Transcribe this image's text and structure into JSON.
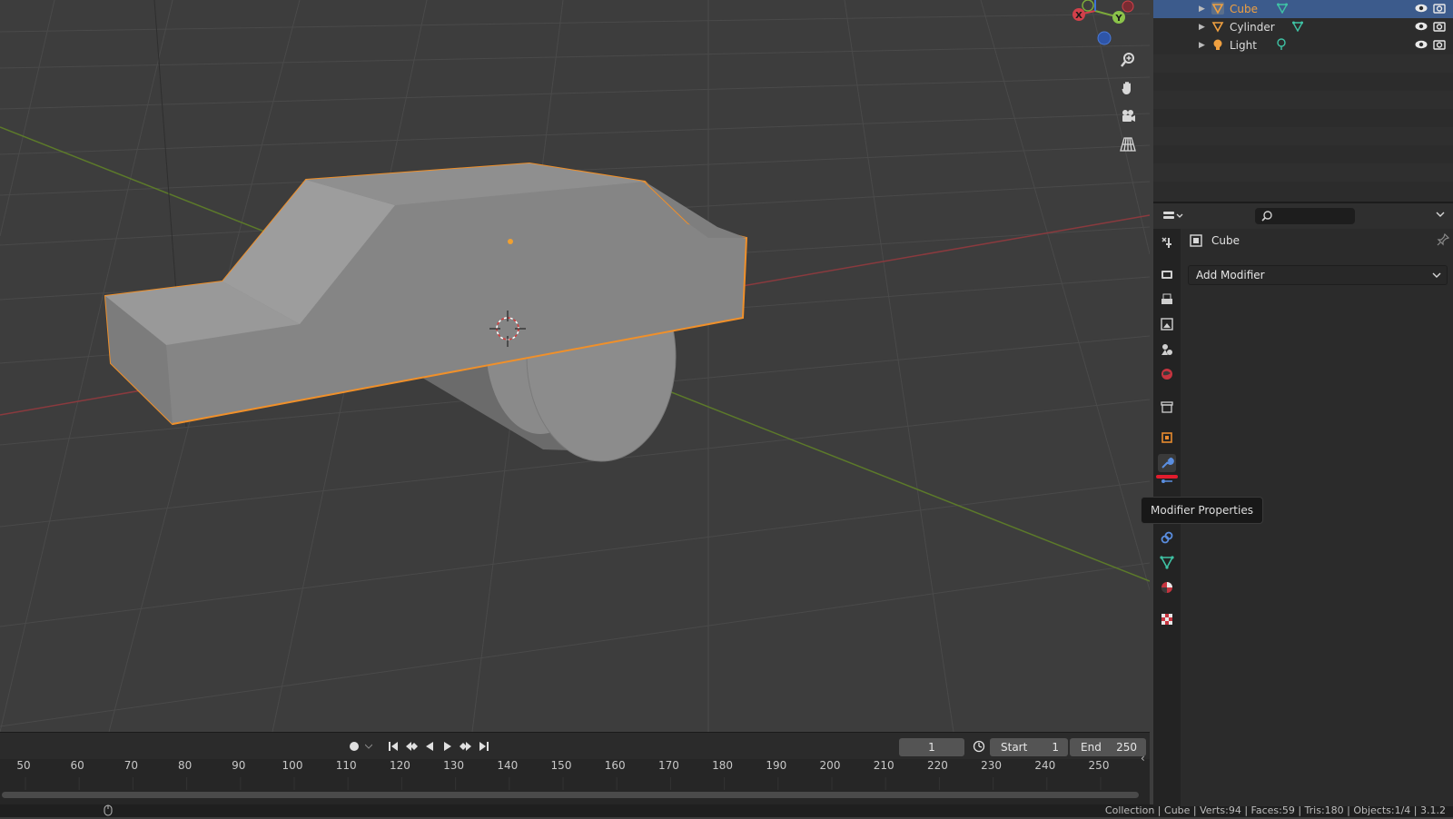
{
  "outliner": {
    "items": [
      {
        "label": "Cube",
        "selected": true,
        "icon": "mesh-object-icon"
      },
      {
        "label": "Cylinder",
        "selected": false,
        "icon": "mesh-object-icon"
      },
      {
        "label": "Light",
        "selected": false,
        "icon": "light-object-icon"
      }
    ]
  },
  "properties": {
    "object_name": "Cube",
    "add_modifier_label": "Add Modifier",
    "search_placeholder": "",
    "active_tab": "modifier-properties",
    "tabs": [
      "tool",
      "render",
      "output",
      "view-layer",
      "scene",
      "world",
      "collection",
      "object",
      "modifier",
      "particles",
      "physics",
      "constraints",
      "data",
      "material",
      "texture"
    ]
  },
  "tooltip": {
    "text": "Modifier Properties"
  },
  "timeline": {
    "current_frame": "1",
    "start_label": "Start",
    "start_value": "1",
    "end_label": "End",
    "end_value": "250",
    "ticks": [
      "50",
      "60",
      "70",
      "80",
      "90",
      "100",
      "110",
      "120",
      "130",
      "140",
      "150",
      "160",
      "170",
      "180",
      "190",
      "200",
      "210",
      "220",
      "230",
      "240",
      "250"
    ]
  },
  "statusbar": {
    "text": "Collection | Cube | Verts:94 | Faces:59 | Tris:180 | Objects:1/4 | 3.1.2"
  },
  "gizmo": {
    "x_label": "X",
    "y_label": "Y"
  },
  "colors": {
    "selection_outline": "#f0902a",
    "x_axis": "#d2404a",
    "y_axis": "#7ba83a",
    "outliner_selected": "#3c5b8c",
    "active_tab_accent": "#e21c2d"
  }
}
